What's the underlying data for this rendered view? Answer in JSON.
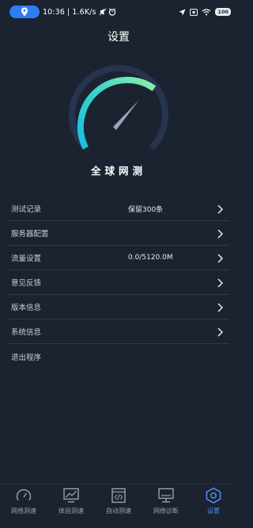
{
  "status_bar": {
    "time_text": "10:36 | 1.6K/s",
    "battery": "100"
  },
  "page_title": "设置",
  "app_name": "全球网测",
  "colors": {
    "background": "#1b2330",
    "accent": "#4f8ff7",
    "gauge_green": "#7ee8a5",
    "gauge_cyan": "#20c5e6",
    "gauge_track": "#26344d"
  },
  "menu": {
    "items": [
      {
        "label": "测试记录",
        "value": "保留300条"
      },
      {
        "label": "服务器配置",
        "value": ""
      },
      {
        "label": "流量设置",
        "value": "0.0/5120.0M"
      },
      {
        "label": "意见反馈",
        "value": ""
      },
      {
        "label": "版本信息",
        "value": ""
      },
      {
        "label": "系统信息",
        "value": ""
      },
      {
        "label": "退出程序",
        "value": ""
      }
    ]
  },
  "bottom_nav": {
    "items": [
      {
        "label": "网络测速",
        "icon": "speedometer-icon"
      },
      {
        "label": "体验测速",
        "icon": "image-monitor-icon"
      },
      {
        "label": "自动测速",
        "icon": "code-window-icon"
      },
      {
        "label": "网络诊断",
        "icon": "monitor-icon"
      },
      {
        "label": "设置",
        "icon": "hexagon-settings-icon"
      }
    ],
    "active_index": 4
  }
}
